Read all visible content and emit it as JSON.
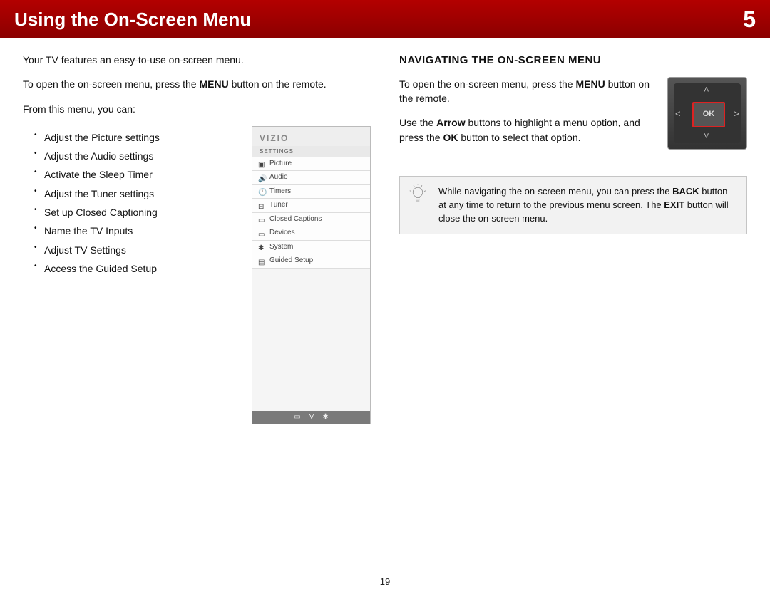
{
  "header": {
    "title": "Using the On-Screen Menu",
    "chapter": "5"
  },
  "left": {
    "intro1": "Your TV features an easy-to-use on-screen menu.",
    "intro2a": "To open the on-screen menu, press the ",
    "intro2_bold": "MENU",
    "intro2b": " button on the remote.",
    "intro3": "From this menu, you can:",
    "bullets": [
      "Adjust the Picture settings",
      "Adjust the Audio settings",
      "Activate the Sleep Timer",
      "Adjust the Tuner settings",
      "Set up Closed Captioning",
      "Name the TV Inputs",
      "Adjust TV Settings",
      "Access the Guided Setup"
    ]
  },
  "menu_shot": {
    "logo": "VIZIO",
    "section": "SETTINGS",
    "items": [
      "Picture",
      "Audio",
      "Timers",
      "Tuner",
      "Closed Captions",
      "Devices",
      "System",
      "Guided Setup"
    ]
  },
  "right": {
    "heading": "NAVIGATING THE ON-SCREEN MENU",
    "p1a": "To open the on-screen menu, press the ",
    "p1_bold": "MENU",
    "p1b": " button on the remote.",
    "p2a": "Use the ",
    "p2_bold1": "Arrow",
    "p2b": " buttons to highlight a menu option, and press the ",
    "p2_bold2": "OK",
    "p2c": " button to select that option.",
    "navpad_ok": "OK",
    "tip_a": "While navigating the on-screen menu, you can press the ",
    "tip_b1": "BACK",
    "tip_b": " button at any time to return to the previous menu screen. The ",
    "tip_b2": "EXIT",
    "tip_c": " button will close the on-screen menu."
  },
  "footer": {
    "page": "19"
  }
}
